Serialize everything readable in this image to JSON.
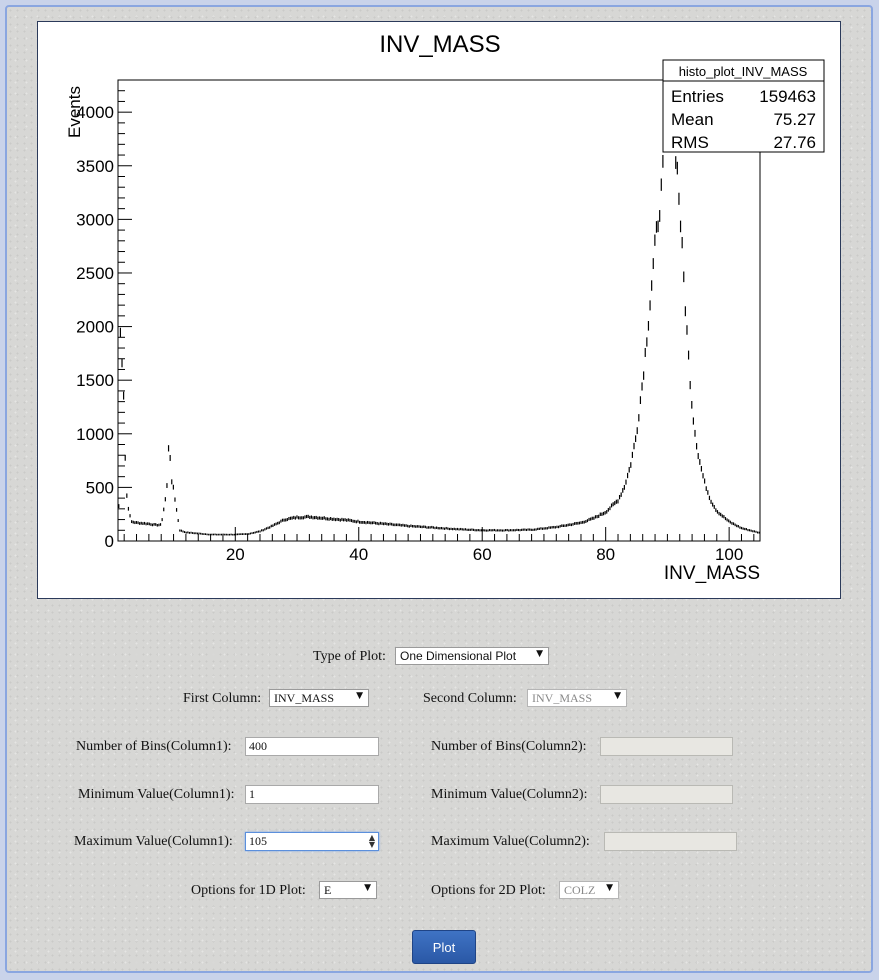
{
  "chart_data": {
    "type": "scatter",
    "title": "INV_MASS",
    "xlabel": "INV_MASS",
    "ylabel": "Events",
    "xlim": [
      1,
      105
    ],
    "ylim": [
      0,
      4300
    ],
    "x_ticks": [
      20,
      40,
      60,
      80,
      100
    ],
    "y_ticks": [
      0,
      500,
      1000,
      1500,
      2000,
      2500,
      3000,
      3500,
      4000
    ],
    "grid": false,
    "marker": "error-bar",
    "stats_box": {
      "name": "histo_plot_INV_MASS",
      "rows": [
        {
          "label": "Entries",
          "value": "159463"
        },
        {
          "label": "Mean",
          "value": "75.27"
        },
        {
          "label": "RMS",
          "value": "27.76"
        }
      ]
    },
    "anchor_points": [
      [
        1.1,
        140
      ],
      [
        1.4,
        2000
      ],
      [
        1.9,
        1400
      ],
      [
        2.3,
        480
      ],
      [
        2.8,
        260
      ],
      [
        3.2,
        180
      ],
      [
        4,
        170
      ],
      [
        5,
        165
      ],
      [
        6,
        160
      ],
      [
        7,
        150
      ],
      [
        8,
        150
      ],
      [
        8.9,
        470
      ],
      [
        9.3,
        1030
      ],
      [
        9.6,
        550
      ],
      [
        10,
        500
      ],
      [
        10.3,
        360
      ],
      [
        11,
        100
      ],
      [
        12,
        80
      ],
      [
        14,
        70
      ],
      [
        16,
        60
      ],
      [
        18,
        60
      ],
      [
        20,
        60
      ],
      [
        22,
        65
      ],
      [
        24,
        90
      ],
      [
        26,
        140
      ],
      [
        28,
        200
      ],
      [
        30,
        220
      ],
      [
        32,
        225
      ],
      [
        34,
        215
      ],
      [
        36,
        205
      ],
      [
        38,
        195
      ],
      [
        40,
        180
      ],
      [
        44,
        160
      ],
      [
        48,
        140
      ],
      [
        52,
        125
      ],
      [
        56,
        110
      ],
      [
        60,
        100
      ],
      [
        64,
        100
      ],
      [
        68,
        105
      ],
      [
        72,
        130
      ],
      [
        76,
        170
      ],
      [
        78,
        210
      ],
      [
        80,
        270
      ],
      [
        82,
        380
      ],
      [
        83,
        500
      ],
      [
        84,
        700
      ],
      [
        85,
        1000
      ],
      [
        86,
        1500
      ],
      [
        87,
        2100
      ],
      [
        88,
        2750
      ],
      [
        89,
        3250
      ],
      [
        89.5,
        3600
      ],
      [
        90,
        3850
      ],
      [
        90.5,
        3950
      ],
      [
        91,
        3800
      ],
      [
        91.5,
        3550
      ],
      [
        92,
        3100
      ],
      [
        92.5,
        2600
      ],
      [
        93,
        2100
      ],
      [
        93.5,
        1650
      ],
      [
        94,
        1250
      ],
      [
        94.5,
        1000
      ],
      [
        95,
        800
      ],
      [
        96,
        550
      ],
      [
        97,
        380
      ],
      [
        98,
        280
      ],
      [
        100,
        180
      ],
      [
        102,
        120
      ],
      [
        104,
        90
      ],
      [
        105,
        75
      ]
    ]
  },
  "form": {
    "type_of_plot": {
      "label": "Type of Plot:",
      "value": "One Dimensional Plot"
    },
    "first_column": {
      "label": "First Column:",
      "value": "INV_MASS"
    },
    "second_column": {
      "label": "Second Column:",
      "value": "INV_MASS"
    },
    "bins_col1": {
      "label": "Number of Bins(Column1):",
      "value": "400"
    },
    "bins_col2": {
      "label": "Number of Bins(Column2):",
      "value": ""
    },
    "min_col1": {
      "label": "Minimum Value(Column1):",
      "value": "1"
    },
    "min_col2": {
      "label": "Minimum Value(Column2):",
      "value": ""
    },
    "max_col1": {
      "label": "Maximum Value(Column1):",
      "value": "105"
    },
    "max_col2": {
      "label": "Maximum Value(Column2):",
      "value": ""
    },
    "opt_1d": {
      "label": "Options for 1D Plot:",
      "value": "E"
    },
    "opt_2d": {
      "label": "Options for 2D Plot:",
      "value": "COLZ"
    },
    "plot_button": "Plot"
  },
  "icons": {
    "dropdown": "chevron-down-icon",
    "spinner": "spinner-arrows-icon"
  },
  "colors": {
    "button": "#2f62b3",
    "frame_border": "#8aa6e0",
    "focus": "#5b8fdc"
  }
}
